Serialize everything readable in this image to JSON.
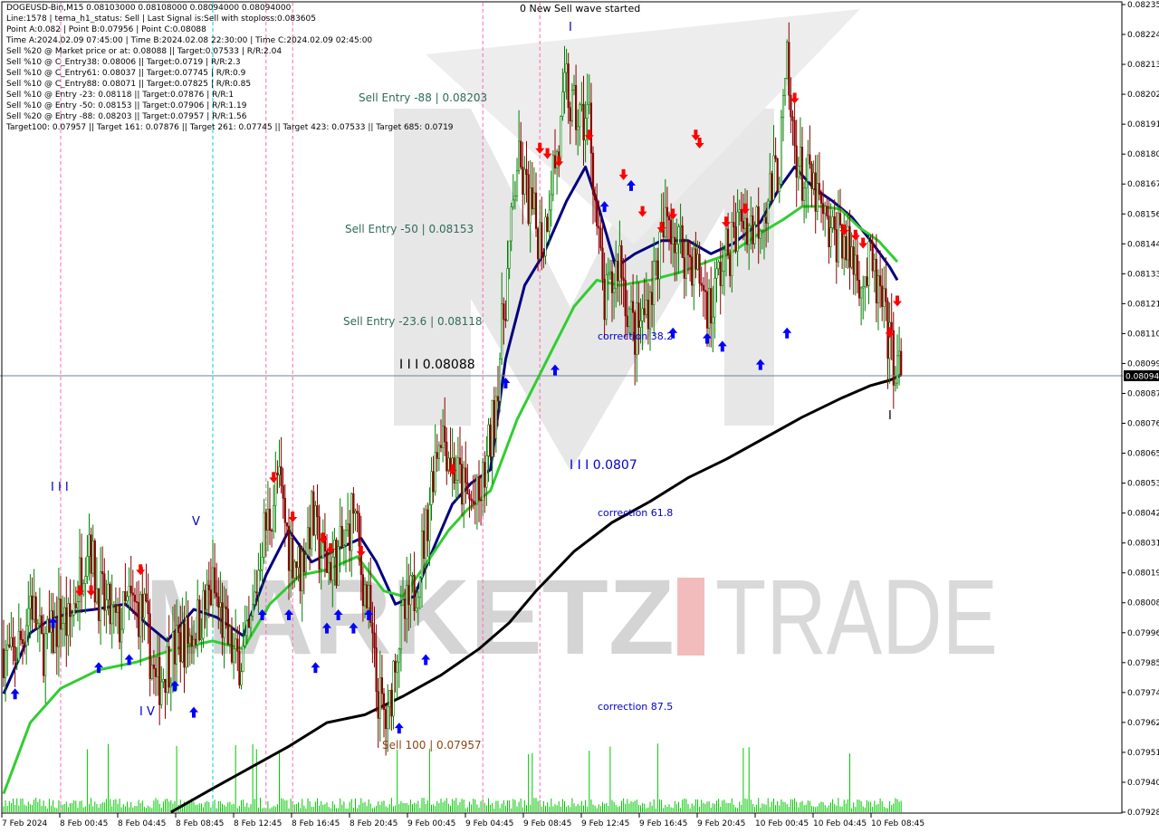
{
  "header": {
    "lines": [
      "DOGEUSD-Bin,M15  0.08103000 0.08108000 0.08094000 0.08094000",
      "Line:1578 | tema_h1_status: Sell | Last Signal is:Sell with stoploss:0.083605",
      "Point A:0.082 | Point B:0.07956 | Point C:0.08088",
      "Time A:2024.02.09 07:45:00 | Time B:2024.02.08 22:30:00 | Time C:2024.02.09 02:45:00",
      "Sell %20 @ Market price or at: 0.08088 || Target:0.07533 | R/R:2.04",
      "Sell %10 @ C_Entry38: 0.08006 || Target:0.0719 | R/R:2.3",
      "Sell %10 @ C_Entry61: 0.08037 || Target:0.07745 | R/R:0.9",
      "Sell %10 @ C_Entry88: 0.08071 || Target:0.07825 | R/R:0.85",
      "Sell %10 @ Entry -23: 0.08118 || Target:0.07876 | R/R:1",
      "Sell %10 @ Entry -50: 0.08153 || Target:0.07906 | R/R:1.19",
      "Sell %20 @ Entry -88: 0.08203 || Target:0.07957 | R/R:1.56",
      "Target100: 0.07957 || Target 161: 0.07876 || Target 261: 0.07745 || Target 423: 0.07533 || Target 685: 0.0719"
    ]
  },
  "annotations": {
    "sell_wave": "0 New Sell wave started",
    "entry_88": "Sell Entry -88 | 0.08203",
    "entry_50": "Sell Entry -50 | 0.08153",
    "entry_236": "Sell Entry -23.6 | 0.08118",
    "level_c": "I I I 0.08088",
    "level_b": "I I I 0.0807",
    "correction_382": "correction 38.2",
    "correction_618": "correction 61.8",
    "correction_875": "correction 87.5",
    "sell_100": "Sell 100 | 0.07957",
    "wave_iii": "I I I",
    "wave_v": "V",
    "wave_iv": "I V",
    "wave_i": "I"
  },
  "watermark": {
    "left": "MARKETZ",
    "mid": "I",
    "right": "TRADE"
  },
  "colors": {
    "bull": "#008000",
    "bear": "#8b0000",
    "ema_blue": "#000080",
    "ema_green": "#32cd32",
    "ema_black": "#000000",
    "volume": "#00c800",
    "vline_magenta": "#ff69b4",
    "vline_cyan": "#00ced1",
    "arrow_up": "#0000ff",
    "arrow_down": "#ff0000",
    "price_line": "#708090"
  },
  "chart_data": {
    "type": "candlestick",
    "symbol": "DOGEUSD-Bin",
    "timeframe": "M15",
    "ohlc": {
      "open": 0.08103,
      "high": 0.08108,
      "low": 0.08094,
      "close": 0.08094
    },
    "current_price_label": "0.08094",
    "ylim": [
      0.07928,
      0.08235
    ],
    "y_ticks": [
      "0.08235",
      "0.08224",
      "0.08213",
      "0.08202",
      "0.08191",
      "0.08180",
      "0.08167",
      "0.08156",
      "0.08144",
      "0.08133",
      "0.08121",
      "0.08110",
      "0.08099",
      "0.08087",
      "0.08076",
      "0.08065",
      "0.08053",
      "0.08042",
      "0.08031",
      "0.08019",
      "0.08008",
      "0.07996",
      "0.07985",
      "0.07974",
      "0.07962",
      "0.07951",
      "0.07940",
      "0.07928"
    ],
    "x_ticks": [
      "7 Feb 2024",
      "8 Feb 00:45",
      "8 Feb 04:45",
      "8 Feb 08:45",
      "8 Feb 12:45",
      "8 Feb 16:45",
      "8 Feb 20:45",
      "9 Feb 00:45",
      "9 Feb 04:45",
      "9 Feb 08:45",
      "9 Feb 12:45",
      "9 Feb 16:45",
      "9 Feb 20:45",
      "10 Feb 00:45",
      "10 Feb 04:45",
      "10 Feb 08:45"
    ],
    "price_path": [
      [
        0,
        0.0799
      ],
      [
        4,
        0.07985
      ],
      [
        10,
        0.07995
      ],
      [
        14,
        0.0801
      ],
      [
        20,
        0.0799
      ],
      [
        26,
        0.07995
      ],
      [
        30,
        0.08003
      ],
      [
        34,
        0.07998
      ],
      [
        38,
        0.0801
      ],
      [
        42,
        0.08025
      ],
      [
        45,
        0.08035
      ],
      [
        48,
        0.08015
      ],
      [
        54,
        0.08005
      ],
      [
        60,
        0.07998
      ],
      [
        66,
        0.08007
      ],
      [
        74,
        0.08003
      ],
      [
        80,
        0.07975
      ],
      [
        86,
        0.07985
      ],
      [
        92,
        0.07992
      ],
      [
        98,
        0.07995
      ],
      [
        104,
        0.08003
      ],
      [
        110,
        0.08013
      ],
      [
        114,
        0.08003
      ],
      [
        118,
        0.07993
      ],
      [
        122,
        0.07985
      ],
      [
        128,
        0.0799
      ],
      [
        130,
        0.07997
      ],
      [
        136,
        0.08033
      ],
      [
        140,
        0.0804
      ],
      [
        144,
        0.08055
      ],
      [
        150,
        0.0803
      ],
      [
        156,
        0.0802
      ],
      [
        162,
        0.0804
      ],
      [
        166,
        0.08028
      ],
      [
        170,
        0.08022
      ],
      [
        176,
        0.08025
      ],
      [
        180,
        0.0803
      ],
      [
        184,
        0.08045
      ],
      [
        188,
        0.0802
      ],
      [
        192,
        0.08005
      ],
      [
        196,
        0.07975
      ],
      [
        202,
        0.0796
      ],
      [
        206,
        0.0799
      ],
      [
        210,
        0.08
      ],
      [
        216,
        0.08012
      ],
      [
        222,
        0.08035
      ],
      [
        226,
        0.0806
      ],
      [
        230,
        0.08075
      ],
      [
        236,
        0.0806
      ],
      [
        242,
        0.0805
      ],
      [
        246,
        0.08045
      ],
      [
        250,
        0.08045
      ],
      [
        254,
        0.0806
      ],
      [
        258,
        0.0808
      ],
      [
        262,
        0.0811
      ],
      [
        266,
        0.0814
      ],
      [
        270,
        0.08175
      ],
      [
        276,
        0.0816
      ],
      [
        280,
        0.0815
      ],
      [
        284,
        0.08145
      ],
      [
        288,
        0.0817
      ],
      [
        292,
        0.0818
      ],
      [
        296,
        0.08205
      ],
      [
        298,
        0.08195
      ],
      [
        304,
        0.0819
      ],
      [
        308,
        0.08193
      ],
      [
        312,
        0.0815
      ],
      [
        316,
        0.0812
      ],
      [
        320,
        0.08128
      ],
      [
        324,
        0.0814
      ],
      [
        328,
        0.0812
      ],
      [
        332,
        0.0811
      ],
      [
        336,
        0.08115
      ],
      [
        340,
        0.08125
      ],
      [
        346,
        0.08145
      ],
      [
        350,
        0.08155
      ],
      [
        354,
        0.08145
      ],
      [
        360,
        0.0814
      ],
      [
        364,
        0.08135
      ],
      [
        368,
        0.08127
      ],
      [
        372,
        0.08118
      ],
      [
        376,
        0.08132
      ],
      [
        380,
        0.0814
      ],
      [
        384,
        0.08145
      ],
      [
        388,
        0.08155
      ],
      [
        394,
        0.0815
      ],
      [
        398,
        0.08155
      ],
      [
        404,
        0.08165
      ],
      [
        408,
        0.08175
      ],
      [
        412,
        0.0821
      ],
      [
        414,
        0.0819
      ],
      [
        420,
        0.08168
      ],
      [
        424,
        0.08167
      ],
      [
        428,
        0.0816
      ],
      [
        432,
        0.0815
      ],
      [
        436,
        0.08145
      ],
      [
        440,
        0.0815
      ],
      [
        444,
        0.0814
      ],
      [
        448,
        0.08137
      ],
      [
        452,
        0.0813
      ],
      [
        456,
        0.08135
      ],
      [
        458,
        0.0813
      ],
      [
        462,
        0.0812
      ],
      [
        466,
        0.08105
      ],
      [
        468,
        0.081
      ],
      [
        470,
        0.08097
      ],
      [
        472,
        0.08094
      ]
    ],
    "series": [
      {
        "name": "",
        "color": "#000080",
        "values": [
          [
            0,
            0.07973
          ],
          [
            14,
            0.07996
          ],
          [
            24,
            0.08001
          ],
          [
            36,
            0.08004
          ],
          [
            48,
            0.08005
          ],
          [
            64,
            0.08007
          ],
          [
            76,
            0.07999
          ],
          [
            86,
            0.07993
          ],
          [
            100,
            0.08005
          ],
          [
            112,
            0.08002
          ],
          [
            126,
            0.07995
          ],
          [
            138,
            0.08018
          ],
          [
            150,
            0.08035
          ],
          [
            162,
            0.08023
          ],
          [
            176,
            0.08028
          ],
          [
            188,
            0.08032
          ],
          [
            196,
            0.08023
          ],
          [
            206,
            0.08007
          ],
          [
            216,
            0.0801
          ],
          [
            226,
            0.08028
          ],
          [
            236,
            0.08045
          ],
          [
            246,
            0.08053
          ],
          [
            256,
            0.08058
          ],
          [
            264,
            0.081
          ],
          [
            274,
            0.08128
          ],
          [
            284,
            0.0814
          ],
          [
            296,
            0.0816
          ],
          [
            306,
            0.08173
          ],
          [
            312,
            0.0816
          ],
          [
            322,
            0.08135
          ],
          [
            332,
            0.0814
          ],
          [
            346,
            0.08145
          ],
          [
            360,
            0.08145
          ],
          [
            372,
            0.0814
          ],
          [
            384,
            0.08144
          ],
          [
            398,
            0.08152
          ],
          [
            408,
            0.08165
          ],
          [
            416,
            0.08173
          ],
          [
            426,
            0.08165
          ],
          [
            436,
            0.0816
          ],
          [
            446,
            0.08154
          ],
          [
            456,
            0.08145
          ],
          [
            466,
            0.08135
          ],
          [
            470,
            0.0813
          ]
        ]
      },
      {
        "name": "",
        "color": "#32cd32",
        "values": [
          [
            0,
            0.07935
          ],
          [
            14,
            0.07962
          ],
          [
            30,
            0.07975
          ],
          [
            50,
            0.07982
          ],
          [
            70,
            0.07985
          ],
          [
            90,
            0.0799
          ],
          [
            110,
            0.07993
          ],
          [
            126,
            0.0799
          ],
          [
            140,
            0.08007
          ],
          [
            156,
            0.08018
          ],
          [
            170,
            0.0802
          ],
          [
            186,
            0.08025
          ],
          [
            200,
            0.08012
          ],
          [
            210,
            0.0801
          ],
          [
            220,
            0.0802
          ],
          [
            234,
            0.08035
          ],
          [
            244,
            0.08043
          ],
          [
            256,
            0.0805
          ],
          [
            270,
            0.08077
          ],
          [
            286,
            0.081
          ],
          [
            300,
            0.0812
          ],
          [
            312,
            0.0813
          ],
          [
            324,
            0.08128
          ],
          [
            340,
            0.0813
          ],
          [
            356,
            0.08133
          ],
          [
            370,
            0.08137
          ],
          [
            382,
            0.0814
          ],
          [
            396,
            0.08147
          ],
          [
            410,
            0.08153
          ],
          [
            420,
            0.08158
          ],
          [
            430,
            0.08158
          ],
          [
            440,
            0.08157
          ],
          [
            450,
            0.0815
          ],
          [
            460,
            0.08145
          ],
          [
            470,
            0.08137
          ]
        ]
      },
      {
        "name": "",
        "color": "#000000",
        "values": [
          [
            88,
            0.07928
          ],
          [
            110,
            0.07937
          ],
          [
            130,
            0.07945
          ],
          [
            150,
            0.07953
          ],
          [
            170,
            0.07962
          ],
          [
            190,
            0.07965
          ],
          [
            210,
            0.07972
          ],
          [
            230,
            0.0798
          ],
          [
            250,
            0.0799
          ],
          [
            266,
            0.08
          ],
          [
            280,
            0.08012
          ],
          [
            300,
            0.08027
          ],
          [
            320,
            0.08038
          ],
          [
            340,
            0.08046
          ],
          [
            360,
            0.08055
          ],
          [
            380,
            0.08062
          ],
          [
            400,
            0.0807
          ],
          [
            420,
            0.08078
          ],
          [
            440,
            0.08085
          ],
          [
            456,
            0.0809
          ],
          [
            466,
            0.08092
          ],
          [
            472,
            0.08094
          ]
        ]
      }
    ],
    "signals_up": [
      [
        6,
        0.07975
      ],
      [
        26,
        0.08002
      ],
      [
        50,
        0.07985
      ],
      [
        66,
        0.07988
      ],
      [
        90,
        0.07978
      ],
      [
        100,
        0.07968
      ],
      [
        136,
        0.08005
      ],
      [
        150,
        0.08005
      ],
      [
        164,
        0.07985
      ],
      [
        170,
        0.08
      ],
      [
        176,
        0.08005
      ],
      [
        184,
        0.08
      ],
      [
        192,
        0.08005
      ],
      [
        208,
        0.07962
      ],
      [
        222,
        0.07988
      ],
      [
        264,
        0.08093
      ],
      [
        290,
        0.08098
      ],
      [
        316,
        0.0816
      ],
      [
        330,
        0.08168
      ],
      [
        352,
        0.08112
      ],
      [
        370,
        0.0811
      ],
      [
        378,
        0.08107
      ],
      [
        398,
        0.081
      ],
      [
        412,
        0.08112
      ]
    ],
    "signals_down": [
      [
        40,
        0.0801
      ],
      [
        46,
        0.0801
      ],
      [
        72,
        0.08018
      ],
      [
        142,
        0.08053
      ],
      [
        152,
        0.08038
      ],
      [
        168,
        0.0803
      ],
      [
        172,
        0.08026
      ],
      [
        188,
        0.08025
      ],
      [
        236,
        0.08056
      ],
      [
        282,
        0.08178
      ],
      [
        286,
        0.08176
      ],
      [
        292,
        0.08173
      ],
      [
        308,
        0.08183
      ],
      [
        326,
        0.08168
      ],
      [
        336,
        0.08154
      ],
      [
        346,
        0.08148
      ],
      [
        352,
        0.08153
      ],
      [
        364,
        0.08183
      ],
      [
        366,
        0.0818
      ],
      [
        380,
        0.0815
      ],
      [
        390,
        0.08155
      ],
      [
        416,
        0.08197
      ],
      [
        442,
        0.08147
      ],
      [
        448,
        0.08145
      ],
      [
        452,
        0.08142
      ],
      [
        466,
        0.08108
      ],
      [
        470,
        0.0812
      ]
    ],
    "vlines_magenta": [
      30,
      138,
      152,
      252,
      282
    ],
    "vlines_cyan": [
      110
    ]
  }
}
